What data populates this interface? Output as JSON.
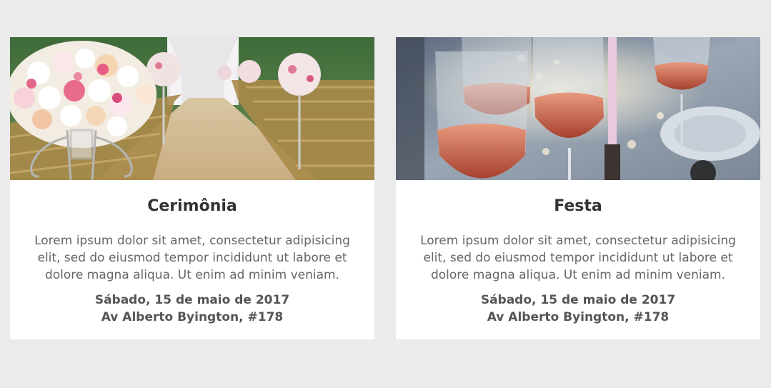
{
  "cards": [
    {
      "title": "Cerimônia",
      "description": "Lorem ipsum dolor sit amet, consectetur adipisicing elit, sed do eiusmod tempor incididunt ut labore et dolore magna aliqua. Ut enim ad minim veniam.",
      "date": "Sábado, 15 de maio de 2017",
      "address": "Av Alberto Byington, #178",
      "image": "wedding-aisle-flowers-photo"
    },
    {
      "title": "Festa",
      "description": "Lorem ipsum dolor sit amet, consectetur adipisicing elit, sed do eiusmod tempor incididunt ut labore et dolore magna aliqua. Ut enim ad minim veniam.",
      "date": "Sábado, 15 de maio de 2017",
      "address": "Av Alberto Byington, #178",
      "image": "rose-wine-glasses-photo"
    }
  ],
  "colors": {
    "background": "#ebebeb",
    "card": "#ffffff",
    "title": "#333333",
    "text": "#666666"
  }
}
